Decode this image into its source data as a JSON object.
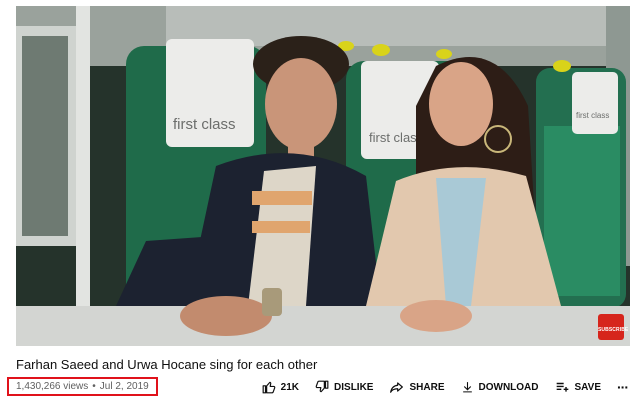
{
  "video": {
    "title": "Farhan Saeed and Urwa Hocane sing for each other",
    "views": "1,430,266 views",
    "separator": "•",
    "date": "Jul 2, 2019",
    "headrest_label": "first class",
    "subscribe_badge": "SUBSCRIBE"
  },
  "actions": {
    "like_count": "21K",
    "dislike_label": "DISLIKE",
    "share_label": "SHARE",
    "download_label": "DOWNLOAD",
    "save_label": "SAVE",
    "more_label": "···"
  },
  "colors": {
    "highlight_border": "#e0121b",
    "subscribe_red": "#d6251c",
    "seat_green": "#1f6b4a",
    "meta_gray": "#606060"
  },
  "icons": [
    "like-icon",
    "dislike-icon",
    "share-icon",
    "download-icon",
    "save-icon",
    "more-icon"
  ]
}
